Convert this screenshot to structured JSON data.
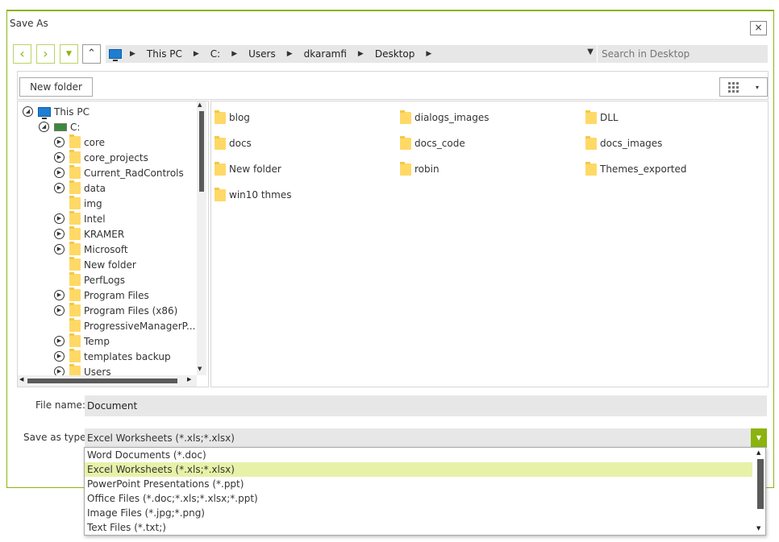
{
  "window": {
    "title": "Save As",
    "close_label": "×"
  },
  "nav": {
    "back": "‹",
    "forward": "›",
    "recent": "▼",
    "up": "⌃"
  },
  "address": {
    "crumbs": [
      "This PC",
      "C:",
      "Users",
      "dkaramfi",
      "Desktop"
    ],
    "separator": "▶",
    "dropdown": "▼"
  },
  "search": {
    "placeholder": "Search in Desktop"
  },
  "toolbar": {
    "new_folder_label": "New folder",
    "view_arrow": "▾"
  },
  "tree": {
    "root": "This PC",
    "drive": "C:",
    "items": [
      {
        "label": "core",
        "expandable": true
      },
      {
        "label": "core_projects",
        "expandable": true
      },
      {
        "label": "Current_RadControls",
        "expandable": true
      },
      {
        "label": "data",
        "expandable": true
      },
      {
        "label": "img",
        "expandable": false
      },
      {
        "label": "Intel",
        "expandable": true
      },
      {
        "label": "KRAMER",
        "expandable": true
      },
      {
        "label": "Microsoft",
        "expandable": true
      },
      {
        "label": "New folder",
        "expandable": false
      },
      {
        "label": "PerfLogs",
        "expandable": false
      },
      {
        "label": "Program Files",
        "expandable": true
      },
      {
        "label": "Program Files (x86)",
        "expandable": true
      },
      {
        "label": "ProgressiveManagerP...",
        "expandable": false
      },
      {
        "label": "Temp",
        "expandable": true
      },
      {
        "label": "templates backup",
        "expandable": true
      },
      {
        "label": "Users",
        "expandable": true
      }
    ]
  },
  "files": [
    "blog",
    "dialogs_images",
    "DLL",
    "docs",
    "docs_code",
    "docs_images",
    "New folder",
    "robin",
    "Themes_exported",
    "win10 thmes"
  ],
  "form": {
    "file_name_label": "File name:",
    "file_name_value": "Document",
    "save_type_label": "Save as type:",
    "save_type_value": "Excel Worksheets (*.xls;*.xlsx)",
    "save_type_arrow": "▼"
  },
  "type_options": [
    "Word Documents (*.doc)",
    "Excel Worksheets (*.xls;*.xlsx)",
    "PowerPoint Presentations (*.ppt)",
    "Office Files (*.doc;*.xls;*.xlsx;*.ppt)",
    "Image Files (*.jpg;*.png)",
    "Text Files (*.txt;)"
  ],
  "selected_type_index": 1,
  "colors": {
    "accent": "#8bb30f",
    "selection": "#e8f1a8",
    "folder": "#ffd966"
  }
}
